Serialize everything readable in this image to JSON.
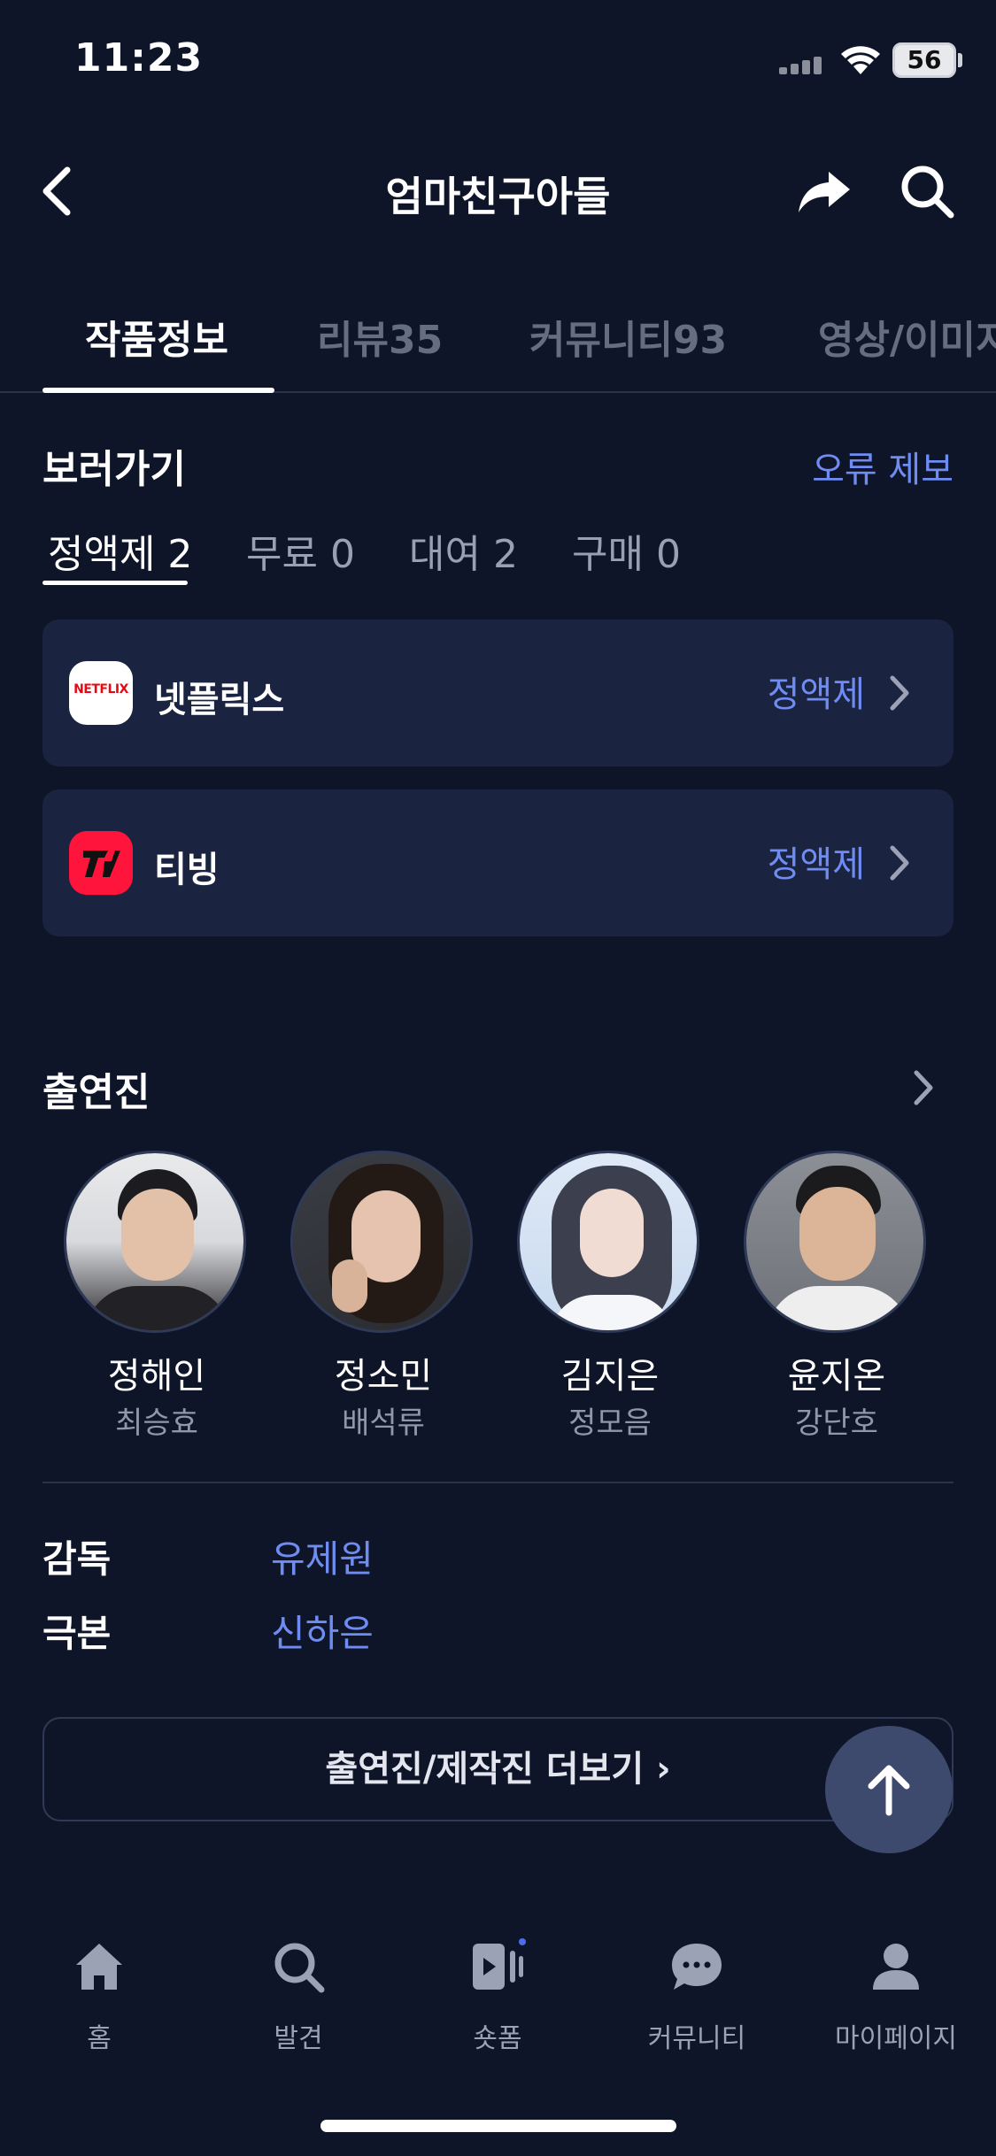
{
  "status_bar": {
    "time": "11:23",
    "battery": "56"
  },
  "header": {
    "title": "엄마친구아들"
  },
  "tabs": [
    {
      "label": "작품정보"
    },
    {
      "label": "리뷰35"
    },
    {
      "label": "커뮤니티93"
    },
    {
      "label": "영상/이미지"
    }
  ],
  "watch": {
    "title": "보러가기",
    "report_link": "오류 제보",
    "subtabs": [
      {
        "label": "정액제 2"
      },
      {
        "label": "무료 0"
      },
      {
        "label": "대여 2"
      },
      {
        "label": "구매 0"
      }
    ],
    "providers": [
      {
        "name": "넷플릭스",
        "type": "정액제",
        "logo_text": "NETFLIX"
      },
      {
        "name": "티빙",
        "type": "정액제",
        "logo_text": "T"
      }
    ]
  },
  "cast": {
    "title": "출연진",
    "members": [
      {
        "name": "정해인",
        "role": "최승효"
      },
      {
        "name": "정소민",
        "role": "배석류"
      },
      {
        "name": "김지은",
        "role": "정모음"
      },
      {
        "name": "윤지온",
        "role": "강단호"
      }
    ]
  },
  "credits": [
    {
      "label": "감독",
      "value": "유제원"
    },
    {
      "label": "극본",
      "value": "신하은"
    }
  ],
  "more_button": "출연진/제작진 더보기 ›",
  "bottom_nav": [
    {
      "label": "홈",
      "icon": "home-icon"
    },
    {
      "label": "발견",
      "icon": "search-icon"
    },
    {
      "label": "숏폼",
      "icon": "shortform-icon"
    },
    {
      "label": "커뮤니티",
      "icon": "chat-icon"
    },
    {
      "label": "마이페이지",
      "icon": "person-icon"
    }
  ],
  "colors": {
    "background": "#0f1528",
    "card": "#1a2340",
    "accent": "#6f8cf2",
    "netflix_red": "#e50914",
    "tving_red": "#ff153c"
  }
}
